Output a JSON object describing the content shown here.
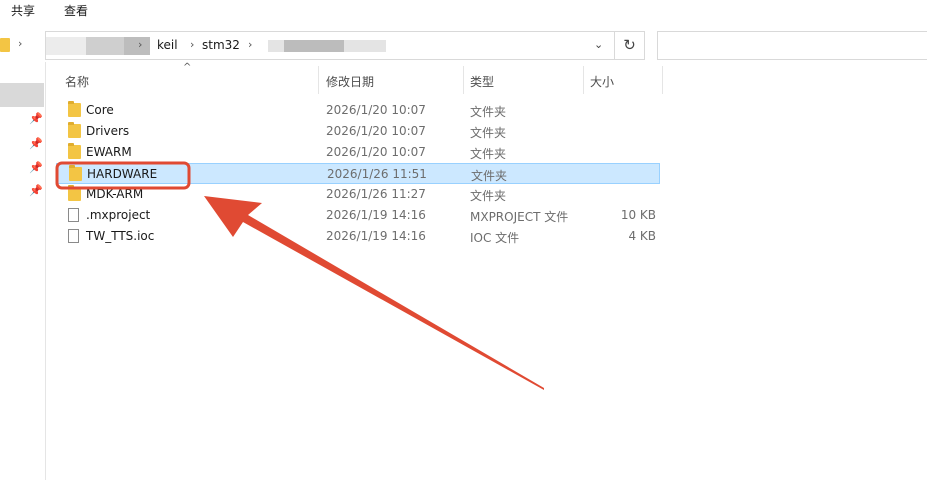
{
  "ribbon": {
    "tabs": [
      "共享",
      "查看"
    ]
  },
  "address": {
    "crumbs": [
      "keil",
      "stm32"
    ]
  },
  "columns": {
    "name": "名称",
    "date": "修改日期",
    "type": "类型",
    "size": "大小"
  },
  "files": [
    {
      "name": "Core",
      "date": "2026/1/20 10:07",
      "type": "文件夹",
      "size": "",
      "kind": "folder",
      "selected": false
    },
    {
      "name": "Drivers",
      "date": "2026/1/20 10:07",
      "type": "文件夹",
      "size": "",
      "kind": "folder",
      "selected": false
    },
    {
      "name": "EWARM",
      "date": "2026/1/20 10:07",
      "type": "文件夹",
      "size": "",
      "kind": "folder",
      "selected": false
    },
    {
      "name": "HARDWARE",
      "date": "2026/1/26 11:51",
      "type": "文件夹",
      "size": "",
      "kind": "folder",
      "selected": true
    },
    {
      "name": "MDK-ARM",
      "date": "2026/1/26 11:27",
      "type": "文件夹",
      "size": "",
      "kind": "folder",
      "selected": false
    },
    {
      "name": ".mxproject",
      "date": "2026/1/19 14:16",
      "type": "MXPROJECT 文件",
      "size": "10 KB",
      "kind": "file",
      "selected": false
    },
    {
      "name": "TW_TTS.ioc",
      "date": "2026/1/19 14:16",
      "type": "IOC 文件",
      "size": "4 KB",
      "kind": "file",
      "selected": false
    }
  ],
  "colors": {
    "selection_fill": "#cce8ff",
    "selection_border": "#99d1ff",
    "annotation": "#e04a33",
    "folder": "#f3c544"
  }
}
